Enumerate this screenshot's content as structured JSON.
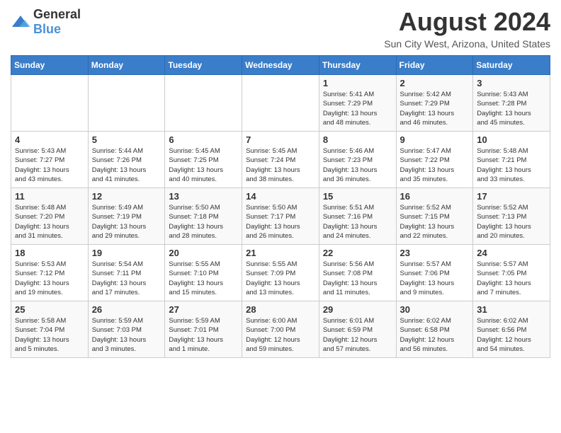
{
  "logo": {
    "text_general": "General",
    "text_blue": "Blue"
  },
  "title": {
    "month_year": "August 2024",
    "location": "Sun City West, Arizona, United States"
  },
  "weekdays": [
    "Sunday",
    "Monday",
    "Tuesday",
    "Wednesday",
    "Thursday",
    "Friday",
    "Saturday"
  ],
  "weeks": [
    [
      {
        "day": "",
        "info": ""
      },
      {
        "day": "",
        "info": ""
      },
      {
        "day": "",
        "info": ""
      },
      {
        "day": "",
        "info": ""
      },
      {
        "day": "1",
        "info": "Sunrise: 5:41 AM\nSunset: 7:29 PM\nDaylight: 13 hours\nand 48 minutes."
      },
      {
        "day": "2",
        "info": "Sunrise: 5:42 AM\nSunset: 7:29 PM\nDaylight: 13 hours\nand 46 minutes."
      },
      {
        "day": "3",
        "info": "Sunrise: 5:43 AM\nSunset: 7:28 PM\nDaylight: 13 hours\nand 45 minutes."
      }
    ],
    [
      {
        "day": "4",
        "info": "Sunrise: 5:43 AM\nSunset: 7:27 PM\nDaylight: 13 hours\nand 43 minutes."
      },
      {
        "day": "5",
        "info": "Sunrise: 5:44 AM\nSunset: 7:26 PM\nDaylight: 13 hours\nand 41 minutes."
      },
      {
        "day": "6",
        "info": "Sunrise: 5:45 AM\nSunset: 7:25 PM\nDaylight: 13 hours\nand 40 minutes."
      },
      {
        "day": "7",
        "info": "Sunrise: 5:45 AM\nSunset: 7:24 PM\nDaylight: 13 hours\nand 38 minutes."
      },
      {
        "day": "8",
        "info": "Sunrise: 5:46 AM\nSunset: 7:23 PM\nDaylight: 13 hours\nand 36 minutes."
      },
      {
        "day": "9",
        "info": "Sunrise: 5:47 AM\nSunset: 7:22 PM\nDaylight: 13 hours\nand 35 minutes."
      },
      {
        "day": "10",
        "info": "Sunrise: 5:48 AM\nSunset: 7:21 PM\nDaylight: 13 hours\nand 33 minutes."
      }
    ],
    [
      {
        "day": "11",
        "info": "Sunrise: 5:48 AM\nSunset: 7:20 PM\nDaylight: 13 hours\nand 31 minutes."
      },
      {
        "day": "12",
        "info": "Sunrise: 5:49 AM\nSunset: 7:19 PM\nDaylight: 13 hours\nand 29 minutes."
      },
      {
        "day": "13",
        "info": "Sunrise: 5:50 AM\nSunset: 7:18 PM\nDaylight: 13 hours\nand 28 minutes."
      },
      {
        "day": "14",
        "info": "Sunrise: 5:50 AM\nSunset: 7:17 PM\nDaylight: 13 hours\nand 26 minutes."
      },
      {
        "day": "15",
        "info": "Sunrise: 5:51 AM\nSunset: 7:16 PM\nDaylight: 13 hours\nand 24 minutes."
      },
      {
        "day": "16",
        "info": "Sunrise: 5:52 AM\nSunset: 7:15 PM\nDaylight: 13 hours\nand 22 minutes."
      },
      {
        "day": "17",
        "info": "Sunrise: 5:52 AM\nSunset: 7:13 PM\nDaylight: 13 hours\nand 20 minutes."
      }
    ],
    [
      {
        "day": "18",
        "info": "Sunrise: 5:53 AM\nSunset: 7:12 PM\nDaylight: 13 hours\nand 19 minutes."
      },
      {
        "day": "19",
        "info": "Sunrise: 5:54 AM\nSunset: 7:11 PM\nDaylight: 13 hours\nand 17 minutes."
      },
      {
        "day": "20",
        "info": "Sunrise: 5:55 AM\nSunset: 7:10 PM\nDaylight: 13 hours\nand 15 minutes."
      },
      {
        "day": "21",
        "info": "Sunrise: 5:55 AM\nSunset: 7:09 PM\nDaylight: 13 hours\nand 13 minutes."
      },
      {
        "day": "22",
        "info": "Sunrise: 5:56 AM\nSunset: 7:08 PM\nDaylight: 13 hours\nand 11 minutes."
      },
      {
        "day": "23",
        "info": "Sunrise: 5:57 AM\nSunset: 7:06 PM\nDaylight: 13 hours\nand 9 minutes."
      },
      {
        "day": "24",
        "info": "Sunrise: 5:57 AM\nSunset: 7:05 PM\nDaylight: 13 hours\nand 7 minutes."
      }
    ],
    [
      {
        "day": "25",
        "info": "Sunrise: 5:58 AM\nSunset: 7:04 PM\nDaylight: 13 hours\nand 5 minutes."
      },
      {
        "day": "26",
        "info": "Sunrise: 5:59 AM\nSunset: 7:03 PM\nDaylight: 13 hours\nand 3 minutes."
      },
      {
        "day": "27",
        "info": "Sunrise: 5:59 AM\nSunset: 7:01 PM\nDaylight: 13 hours\nand 1 minute."
      },
      {
        "day": "28",
        "info": "Sunrise: 6:00 AM\nSunset: 7:00 PM\nDaylight: 12 hours\nand 59 minutes."
      },
      {
        "day": "29",
        "info": "Sunrise: 6:01 AM\nSunset: 6:59 PM\nDaylight: 12 hours\nand 57 minutes."
      },
      {
        "day": "30",
        "info": "Sunrise: 6:02 AM\nSunset: 6:58 PM\nDaylight: 12 hours\nand 56 minutes."
      },
      {
        "day": "31",
        "info": "Sunrise: 6:02 AM\nSunset: 6:56 PM\nDaylight: 12 hours\nand 54 minutes."
      }
    ]
  ]
}
